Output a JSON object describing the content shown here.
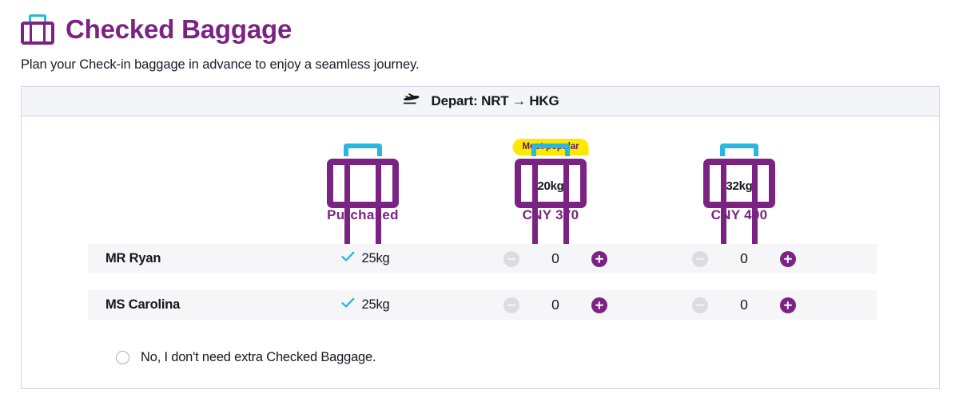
{
  "page": {
    "title": "Checked Baggage",
    "subtitle": "Plan your Check-in baggage in advance to enjoy a seamless journey.",
    "title_icon": "suitcase-icon"
  },
  "colors": {
    "brand_purple": "#7B2382",
    "accent_cyan": "#29B6E0",
    "badge_yellow": "#FFE800",
    "row_stripe": "#f6f6f8",
    "header_band": "#f4f5f9",
    "border": "#d3d6e6"
  },
  "flight": {
    "header_label": "Depart: NRT → HKG",
    "icon": "airplane-takeoff-icon",
    "origin": "NRT",
    "destination": "HKG"
  },
  "options": [
    {
      "id": "purchased",
      "label": "Purchased",
      "weight": "",
      "badge": "",
      "type": "included",
      "icon": "suitcase-icon"
    },
    {
      "id": "extra-20kg",
      "label": "CNY  370",
      "weight": "20kg",
      "badge": "Most popular",
      "type": "stepper",
      "icon": "suitcase-icon"
    },
    {
      "id": "extra-32kg",
      "label": "CNY  490",
      "weight": "32kg",
      "badge": "",
      "type": "stepper",
      "icon": "suitcase-icon"
    }
  ],
  "passengers": [
    {
      "name": "MR Ryan",
      "purchased": "25kg",
      "purchased_icon": "check-icon",
      "qty_20kg": "0",
      "qty_32kg": "0"
    },
    {
      "name": "MS Carolina",
      "purchased": "25kg",
      "purchased_icon": "check-icon",
      "qty_20kg": "0",
      "qty_32kg": "0"
    }
  ],
  "decline": {
    "label": "No, I don't need extra Checked Baggage.",
    "selected": false
  },
  "stepper_buttons": {
    "decrement": "−",
    "increment": "+"
  }
}
